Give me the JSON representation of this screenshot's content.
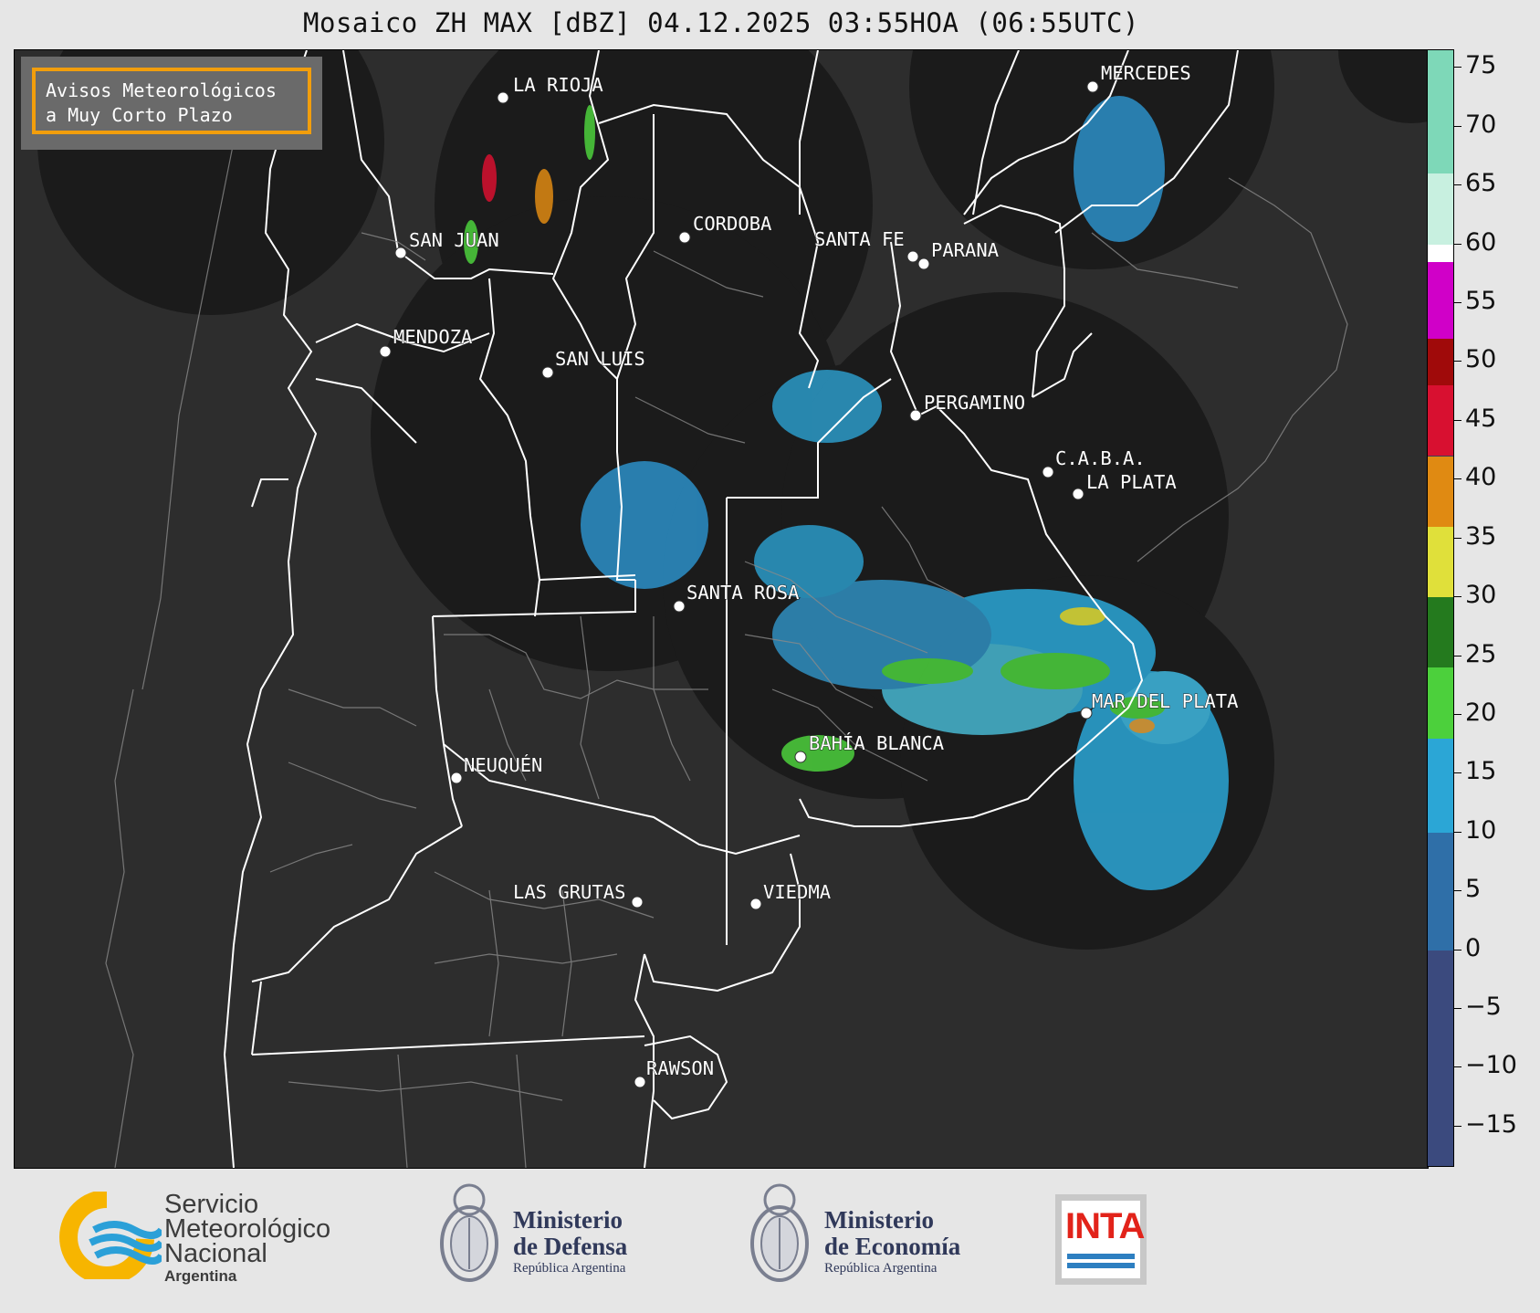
{
  "title": "Mosaico ZH MAX [dBZ] 04.12.2025 03:55HOA (06:55UTC)",
  "warning_box": {
    "line1": "Avisos Meteorológicos",
    "line2": "a Muy Corto Plazo",
    "border_color": "#f29e0c"
  },
  "cities": [
    {
      "name": "LA RIOJA"
    },
    {
      "name": "SAN JUAN"
    },
    {
      "name": "CORDOBA"
    },
    {
      "name": "SANTA FE"
    },
    {
      "name": "PARANA"
    },
    {
      "name": "MERCEDES"
    },
    {
      "name": "MENDOZA"
    },
    {
      "name": "SAN LUIS"
    },
    {
      "name": "PERGAMINO"
    },
    {
      "name": "C.A.B.A."
    },
    {
      "name": "LA PLATA"
    },
    {
      "name": "SANTA ROSA"
    },
    {
      "name": "MAR DEL PLATA"
    },
    {
      "name": "BAHÍA BLANCA"
    },
    {
      "name": "NEUQUÉN"
    },
    {
      "name": "LAS GRUTAS"
    },
    {
      "name": "VIEDMA"
    },
    {
      "name": "RAWSON"
    }
  ],
  "colorbar": {
    "unit": "dBZ",
    "ticks": [
      "75",
      "70",
      "65",
      "60",
      "55",
      "50",
      "45",
      "40",
      "35",
      "30",
      "25",
      "20",
      "15",
      "10",
      "5",
      "0",
      "−5",
      "−10",
      "−15"
    ],
    "range": [
      -18.5,
      76.5
    ],
    "segments": [
      {
        "from": -18.5,
        "to": 0,
        "color": "#3b4a7e"
      },
      {
        "from": 0,
        "to": 10,
        "color": "#2f6fa8"
      },
      {
        "from": 10,
        "to": 18,
        "color": "#2ba6d6"
      },
      {
        "from": 18,
        "to": 24,
        "color": "#4cd03c"
      },
      {
        "from": 24,
        "to": 30,
        "color": "#247a1e"
      },
      {
        "from": 30,
        "to": 36,
        "color": "#e0e03a"
      },
      {
        "from": 36,
        "to": 42,
        "color": "#e08a12"
      },
      {
        "from": 42,
        "to": 48,
        "color": "#d81030"
      },
      {
        "from": 48,
        "to": 52,
        "color": "#a00a0a"
      },
      {
        "from": 52,
        "to": 58.5,
        "color": "#d000c8"
      },
      {
        "from": 58.5,
        "to": 60,
        "color": "#ffffff"
      },
      {
        "from": 60,
        "to": 66,
        "color": "#c8f0e0"
      },
      {
        "from": 66,
        "to": 76.5,
        "color": "#7ed8b8"
      }
    ]
  },
  "footer": {
    "smn": {
      "line1": "Servicio",
      "line2": "Meteorológico",
      "line3": "Nacional",
      "line4": "Argentina"
    },
    "defensa": {
      "line1": "Ministerio",
      "line2": "de Defensa",
      "line3": "República Argentina"
    },
    "economia": {
      "line1": "Ministerio",
      "line2": "de Economía",
      "line3": "República Argentina"
    },
    "inta": {
      "label": "INTA"
    }
  }
}
